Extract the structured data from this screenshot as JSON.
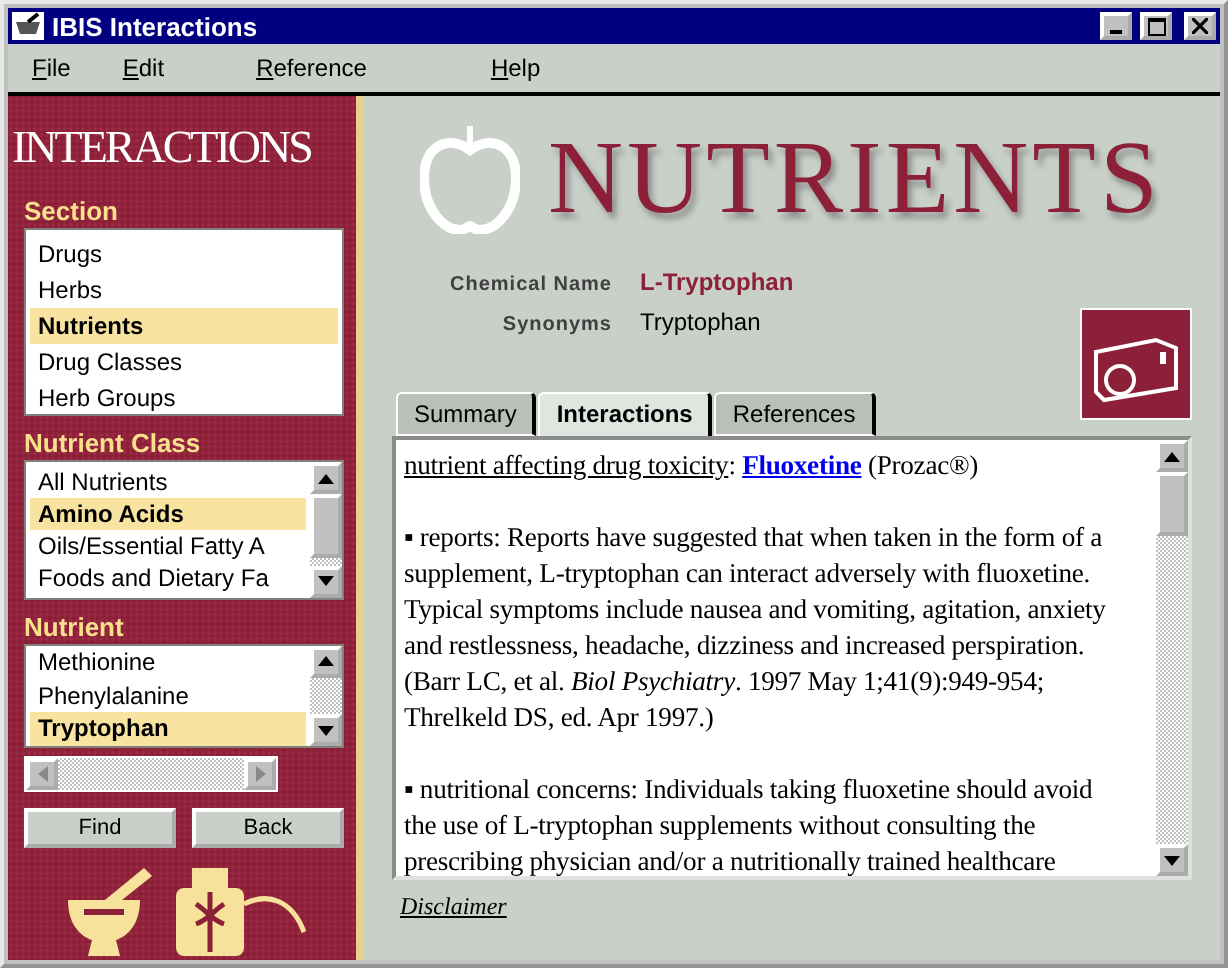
{
  "window": {
    "title": "IBIS Interactions"
  },
  "menu": [
    "File",
    "Edit",
    "Reference",
    "Help"
  ],
  "sidebar": {
    "logo": "INTERACTIONS",
    "section": {
      "label": "Section",
      "items": [
        {
          "label": "Drugs",
          "selected": false
        },
        {
          "label": "Herbs",
          "selected": false
        },
        {
          "label": "Nutrients",
          "selected": true
        },
        {
          "label": "Drug Classes",
          "selected": false
        },
        {
          "label": "Herb Groups",
          "selected": false
        }
      ]
    },
    "nutrient_class": {
      "label": "Nutrient Class",
      "items": [
        {
          "label": "All Nutrients",
          "selected": false
        },
        {
          "label": "Amino Acids",
          "selected": true
        },
        {
          "label": "Oils/Essential Fatty A",
          "selected": false
        },
        {
          "label": "Foods and Dietary Fa",
          "selected": false
        }
      ]
    },
    "nutrient": {
      "label": "Nutrient",
      "items": [
        {
          "label": "Methionine",
          "selected": false
        },
        {
          "label": "Phenylalanine",
          "selected": false
        },
        {
          "label": "Tryptophan",
          "selected": true
        }
      ]
    },
    "buttons": [
      "Find",
      "Back"
    ]
  },
  "header": {
    "title": "NUTRIENTS"
  },
  "details": {
    "chemical_name_label": "Chemical Name",
    "chemical_name": "L-Tryptophan",
    "synonyms_label": "Synonyms",
    "synonyms": "Tryptophan"
  },
  "tabs": [
    {
      "label": "Summary",
      "selected": false
    },
    {
      "label": "Interactions",
      "selected": true
    },
    {
      "label": "References",
      "selected": false
    }
  ],
  "content": {
    "heading": "nutrient affecting drug toxicity",
    "separator": ":",
    "link": "Fluoxetine",
    "link_note": "(Prozac®)",
    "paragraphs": [
      "▪ reports: Reports have suggested that when taken in the form of a supplement, L-tryptophan can interact adversely with fluoxetine. Typical symptoms include nausea and vomiting, agitation, anxiety and restlessness, headache, dizziness and increased perspiration. (Barr LC, et al. *Biol Psychiatry*. 1997 May 1;41(9):949-954; Threlkeld DS, ed. Apr 1997.)",
      "▪ nutritional concerns: Individuals taking fluoxetine should avoid the use of L-tryptophan supplements without consulting the prescribing physician and/or a nutritionally trained healthcare"
    ]
  },
  "footer": {
    "link": "Disclaimer"
  }
}
